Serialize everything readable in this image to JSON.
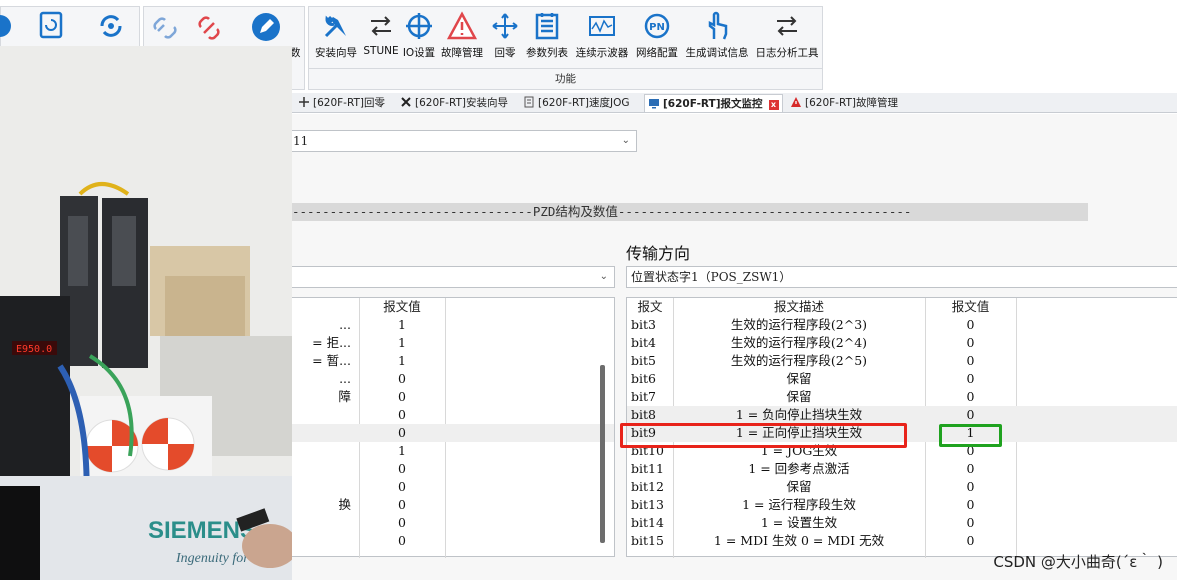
{
  "ribbon": {
    "group_label": "功能",
    "partial_label": "数",
    "buttons": [
      {
        "label": "安装向导",
        "icon": "wrench-screwdriver-icon"
      },
      {
        "label": "STUNE",
        "icon": "arrows-tune-icon"
      },
      {
        "label": "IO设置",
        "icon": "crosshair-icon"
      },
      {
        "label": "故障管理",
        "icon": "warning-triangle-icon"
      },
      {
        "label": "回零",
        "icon": "home-return-icon"
      },
      {
        "label": "参数列表",
        "icon": "list-table-icon"
      },
      {
        "label": "连续示波器",
        "icon": "oscilloscope-icon"
      },
      {
        "label": "网络配置",
        "icon": "network-pn-icon"
      },
      {
        "label": "生成调试信息",
        "icon": "touch-hand-icon"
      },
      {
        "label": "日志分析工具",
        "icon": "log-arrows-icon"
      }
    ]
  },
  "tabs": [
    {
      "label": "[620F-RT]回零",
      "icon": "home-return-icon"
    },
    {
      "label": "[620F-RT]安装向导",
      "icon": "wrench-screwdriver-icon"
    },
    {
      "label": "[620F-RT]速度JOG",
      "icon": "speed-jog-icon"
    },
    {
      "label": "[620F-RT]报文监控",
      "icon": "monitor-icon",
      "active": true
    },
    {
      "label": "[620F-RT]故障管理",
      "icon": "warning-triangle-icon"
    }
  ],
  "top_combo": {
    "value": "11"
  },
  "pzd": {
    "title": "--------------------------------PZD结构及数值---------------------------------------"
  },
  "direction": {
    "label": "传输方向"
  },
  "right_combo": {
    "value": "位置状态字1（POS_ZSW1）"
  },
  "left_table": {
    "header_value": "报文值",
    "rows": [
      {
        "desc": "...",
        "value": "1"
      },
      {
        "desc": "= 拒...",
        "value": "1"
      },
      {
        "desc": "= 暂...",
        "value": "1"
      },
      {
        "desc": "...",
        "value": "0"
      },
      {
        "desc": "障",
        "value": "0"
      },
      {
        "desc": "",
        "value": "0"
      },
      {
        "desc": "",
        "value": "0"
      },
      {
        "desc": "",
        "value": "1"
      },
      {
        "desc": "",
        "value": "0"
      },
      {
        "desc": "",
        "value": "0"
      },
      {
        "desc": "换",
        "value": "0"
      },
      {
        "desc": "",
        "value": "0"
      },
      {
        "desc": "",
        "value": "0"
      }
    ]
  },
  "right_table": {
    "headers": [
      "报文",
      "报文描述",
      "报文值"
    ],
    "rows": [
      {
        "bit": "bit3",
        "desc": "生效的运行程序段(2^3)",
        "value": "0"
      },
      {
        "bit": "bit4",
        "desc": "生效的运行程序段(2^4)",
        "value": "0"
      },
      {
        "bit": "bit5",
        "desc": "生效的运行程序段(2^5)",
        "value": "0"
      },
      {
        "bit": "bit6",
        "desc": "保留",
        "value": "0"
      },
      {
        "bit": "bit7",
        "desc": "保留",
        "value": "0"
      },
      {
        "bit": "bit8",
        "desc": "1 = 负向停止挡块生效",
        "value": "0"
      },
      {
        "bit": "bit9",
        "desc": "1 = 正向停止挡块生效",
        "value": "1"
      },
      {
        "bit": "bit10",
        "desc": "1 = JOG生效",
        "value": "0"
      },
      {
        "bit": "bit11",
        "desc": "1 = 回参考点激活",
        "value": "0"
      },
      {
        "bit": "bit12",
        "desc": "保留",
        "value": "0"
      },
      {
        "bit": "bit13",
        "desc": "1 = 运行程序段生效",
        "value": "0"
      },
      {
        "bit": "bit14",
        "desc": "1 = 设置生效",
        "value": "0"
      },
      {
        "bit": "bit15",
        "desc": "1 = MDI 生效  0 = MDI 无效",
        "value": "0"
      }
    ]
  },
  "photo": {
    "siemens_text": "SIEMENS",
    "slogan": "Ingenuity for life",
    "display_value": "E950.0"
  },
  "watermark": "CSDN @大小曲奇(´ε｀ )",
  "colors": {
    "highlight_red": "#e8231a",
    "highlight_green": "#1fa21f",
    "accent_blue": "#1a73c9"
  }
}
